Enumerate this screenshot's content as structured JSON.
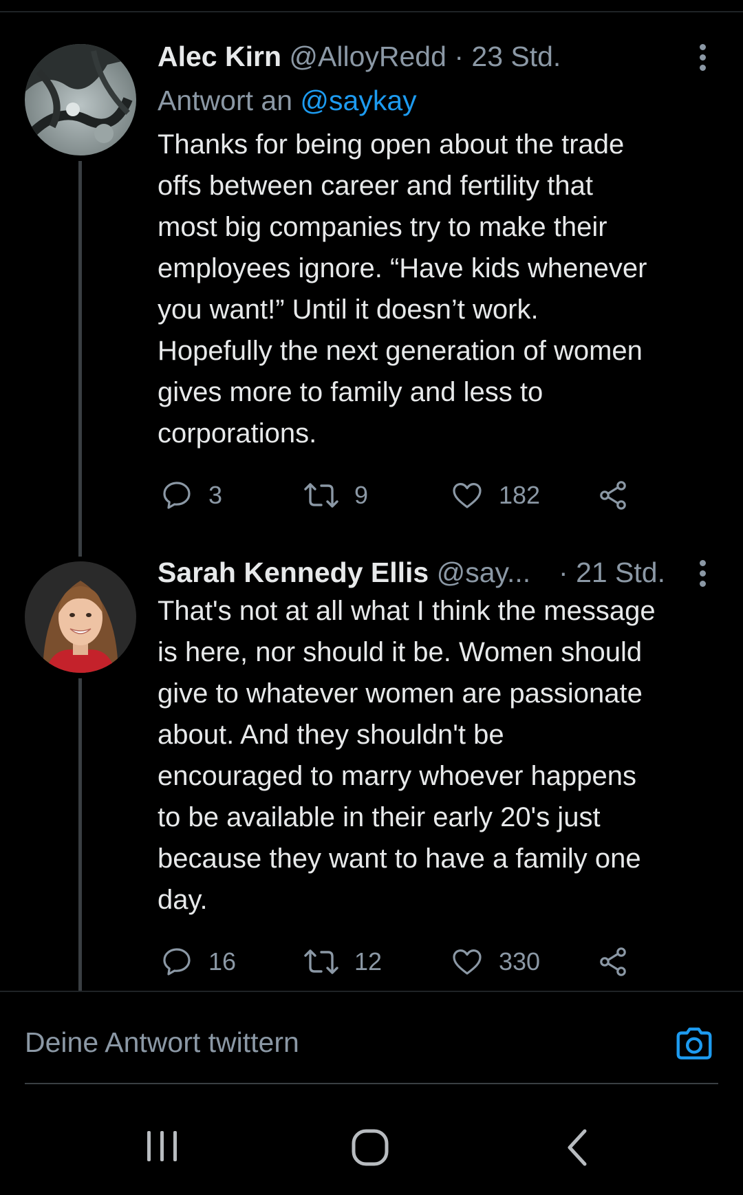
{
  "tweets": [
    {
      "display_name": "Alec Kirn",
      "handle": "@AlloyRedd",
      "separator": "·",
      "time": "23 Std.",
      "reply_prefix": "Antwort an",
      "reply_mention": "@saykay",
      "text": "Thanks for being open about the trade\noffs between career and fertility that\nmost big companies try to make their\nemployees ignore. “Have kids whenever\nyou want!” Until it doesn’t work.\nHopefully the next generation of women\ngives more to family and less to\ncorporations.",
      "replies": "3",
      "retweets": "9",
      "likes": "182",
      "avatar_icon": "avatar-photo-tree-branches"
    },
    {
      "display_name": "Sarah Kennedy Ellis",
      "handle": "@say...",
      "separator": "·",
      "time": "21 Std.",
      "text": "That's not at all what I think the message\nis here, nor should it be. Women should\ngive to whatever women are passionate\nabout. And they shouldn't be\nencouraged to marry whoever happens\nto be available in their early 20's just\nbecause they want to have a family one\nday.",
      "replies": "16",
      "retweets": "12",
      "likes": "330",
      "avatar_icon": "avatar-photo-woman-portrait"
    }
  ],
  "compose": {
    "placeholder": "Deine Antwort twittern",
    "camera_icon": "camera-icon"
  },
  "icons": {
    "reply": "reply-icon",
    "retweet": "retweet-icon",
    "like": "heart-icon",
    "share": "share-icon",
    "more": "more-vertical-icon"
  },
  "navbar": {
    "recents_icon": "recent-apps-icon",
    "home_icon": "home-icon",
    "back_icon": "back-icon"
  },
  "colors": {
    "background": "#000000",
    "text_primary": "#e7e9ea",
    "text_secondary": "#8b98a5",
    "accent": "#1d9bf0",
    "thread_line": "#3a3f43"
  }
}
